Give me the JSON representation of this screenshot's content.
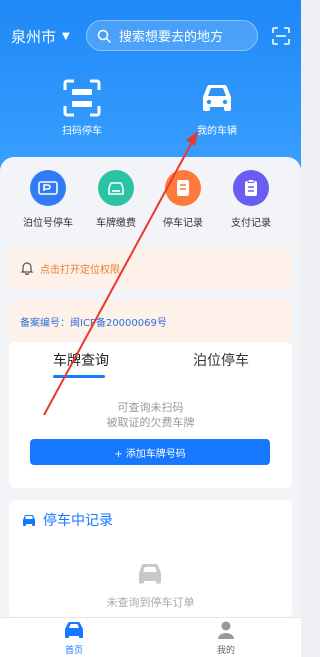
{
  "header": {
    "city": "泉州市",
    "search_placeholder": "搜索想要去的地方"
  },
  "hero_actions": [
    {
      "label": "扫码停车",
      "icon": "scan-icon"
    },
    {
      "label": "我的车辆",
      "icon": "car-icon"
    }
  ],
  "quick_actions": [
    {
      "label": "泊位号停车",
      "icon": "parking-ticket-icon",
      "color": "#2f7cf6"
    },
    {
      "label": "车牌缴费",
      "icon": "car-pay-icon",
      "color": "#2bc3a6"
    },
    {
      "label": "停车记录",
      "icon": "document-icon",
      "color": "#ff7a3d"
    },
    {
      "label": "支付记录",
      "icon": "receipt-icon",
      "color": "#6a5df2"
    }
  ],
  "notice": {
    "text": "点击打开定位权限",
    "color": "#f07c2a"
  },
  "icp": {
    "text": "备案编号：闽ICP备20000069号"
  },
  "query_card": {
    "tabs": [
      "车牌查询",
      "泊位停车"
    ],
    "active_tab": 0,
    "hint_line1": "可查询未扫码",
    "hint_line2": "被取证的欠费车牌",
    "add_button": "+ 添加车牌号码"
  },
  "parking_card": {
    "title": "停车中记录",
    "empty_text": "未查询到停车订单"
  },
  "bottom_nav": [
    {
      "label": "首页",
      "icon": "car-home-icon",
      "active": true
    },
    {
      "label": "我的",
      "icon": "user-icon",
      "active": false
    }
  ],
  "colors": {
    "primary": "#1677ff",
    "annotation": "#e8392e"
  }
}
